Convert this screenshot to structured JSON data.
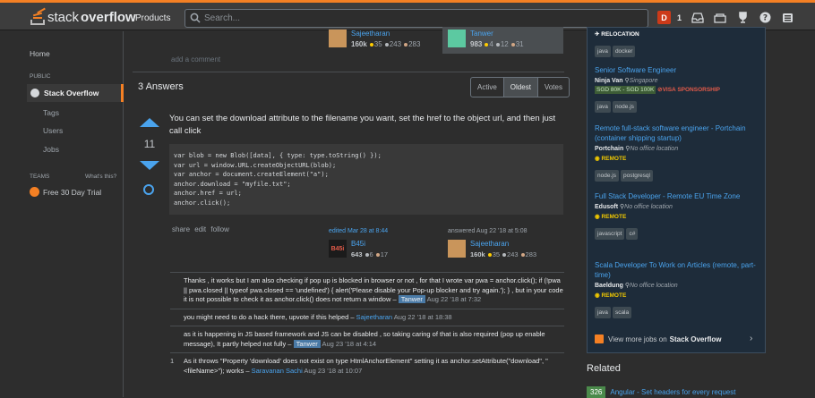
{
  "topbar": {
    "logo_text_1": "stack",
    "logo_text_2": "overflow",
    "products": "Products",
    "search_placeholder": "Search...",
    "avatar_letter": "D",
    "reputation": "1",
    "icons": [
      "inbox-icon",
      "achievements-icon",
      "trophy-icon",
      "help-icon",
      "site-switcher-icon"
    ]
  },
  "leftnav": {
    "home": "Home",
    "public": "PUBLIC",
    "stack_overflow": "Stack Overflow",
    "tags": "Tags",
    "users": "Users",
    "jobs": "Jobs",
    "teams": "TEAMS",
    "whats_this": "What's this?",
    "trial": "Free 30 Day Trial"
  },
  "question_users": [
    {
      "name": "Sajeetharan",
      "rep": "160k",
      "gold": "35",
      "silver": "243",
      "bronze": "283"
    },
    {
      "name": "Tanwer",
      "rep": "983",
      "gold": "4",
      "silver": "12",
      "bronze": "31"
    }
  ],
  "add_comment": "add a comment",
  "answers": {
    "header": "3 Answers",
    "tabs": [
      "Active",
      "Oldest",
      "Votes"
    ],
    "selected_tab": "Oldest"
  },
  "answer": {
    "votes": "11",
    "body": "You can set the download attribute to the filename you want, set the href to the object url, and then just call click",
    "code_lines": [
      "var blob = new Blob([data], { type: type.toString() });",
      "var url = window.URL.createObjectURL(blob);",
      "var anchor = document.createElement(\"a\");",
      "anchor.download = \"myfile.txt\";",
      "anchor.href = url;",
      "anchor.click();"
    ],
    "menu": [
      "share",
      "edit",
      "follow"
    ],
    "edited": {
      "label": "edited Mar 28 at 8:44",
      "name": "B45i",
      "rep": "643",
      "silver": "6",
      "bronze": "17",
      "avatar_text": "B45i"
    },
    "answered": {
      "label": "answered Aug 22 '18 at 5:08",
      "name": "Sajeetharan",
      "rep": "160k",
      "gold": "35",
      "silver": "243",
      "bronze": "283"
    }
  },
  "comments": [
    {
      "score": "",
      "text": "Thanks , it works but I am also checking if pop up is blocked in browser or not , for that I wrote var pwa = anchor.click(); if (!pwa || pwa.closed || typeof pwa.closed == 'undefined') { alert('Please disable your Pop-up blocker and try again.'); } , but in your code it is not possible to check it as anchor.click() does not return a window –",
      "user": "Tanwer",
      "owner": true,
      "date": "Aug 22 '18 at 7:32"
    },
    {
      "score": "",
      "text": "you might need to do a hack there, upvote if this helped –",
      "user": "Sajeetharan",
      "owner": false,
      "date": "Aug 22 '18 at 18:38"
    },
    {
      "score": "",
      "text": "as it is happening in JS based framework and JS can be disabled , so taking caring of that is also required (pop up enable message), It partly helped not fully –",
      "user": "Tanwer",
      "owner": true,
      "date": "Aug 23 '18 at 4:14"
    },
    {
      "score": "1",
      "text": "As it throws \"Property 'download' does not exist on type HtmlAnchorElement\" setting it as anchor.setAttribute(\"download\", \"<fileName>\"); works –",
      "user": "Saravanan Sachi",
      "owner": false,
      "date": "Aug 23 '18 at 10:07"
    }
  ],
  "sidebar": {
    "relocation": "RELOCATION",
    "top_tags": [
      "java",
      "docker"
    ],
    "jobs": [
      {
        "title": "Senior Software Engineer",
        "company": "Ninja Van",
        "location": "Singapore",
        "salary": "SGD 80K - SGD 100K",
        "visa": "VISA SPONSORSHIP",
        "remote": "",
        "tags": [
          "java",
          "node.js"
        ]
      },
      {
        "title": "Remote full-stack software engineer - Portchain (container shipping startup)",
        "company": "Portchain",
        "location": "No office location",
        "salary": "",
        "visa": "",
        "remote": "REMOTE",
        "tags": [
          "node.js",
          "postgresql"
        ]
      },
      {
        "title": "Full Stack Developer - Remote EU Time Zone",
        "company": "Edusoft",
        "location": "No office location",
        "salary": "",
        "visa": "",
        "remote": "REMOTE",
        "tags": [
          "javascript",
          "c#"
        ]
      },
      {
        "title": "Scala Developer To Work on Articles (remote, part-time)",
        "company": "Baeldung",
        "location": "No office location",
        "salary": "",
        "visa": "",
        "remote": "REMOTE",
        "tags": [
          "java",
          "scala"
        ]
      }
    ],
    "view_more": "View more jobs on",
    "view_more_bold": "Stack Overflow"
  },
  "related": {
    "header": "Related",
    "first": {
      "count": "326",
      "title": "Angular - Set headers for every request"
    }
  }
}
